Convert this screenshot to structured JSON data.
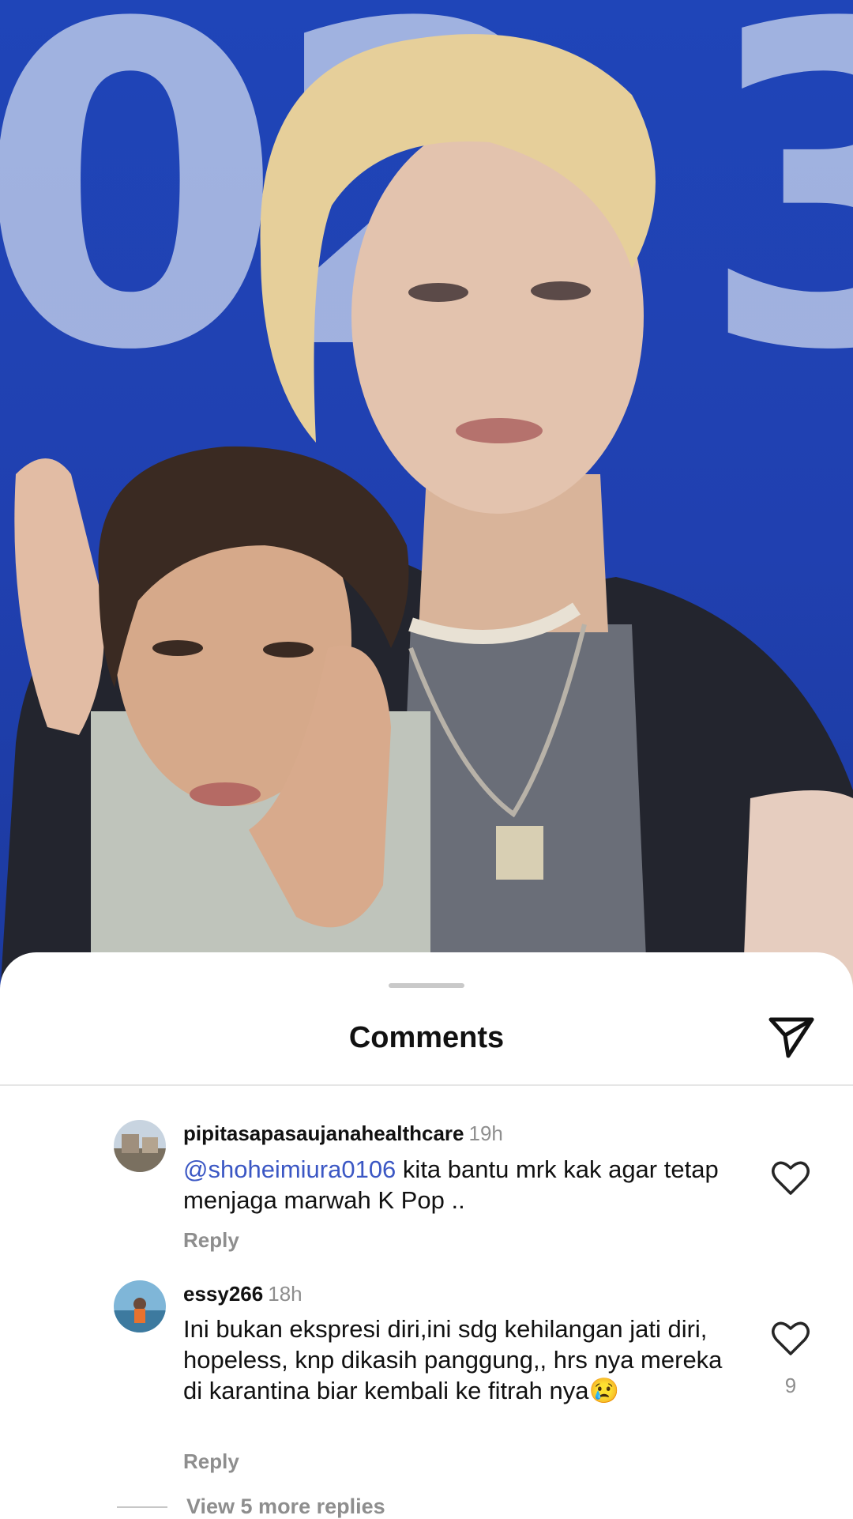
{
  "video": {
    "background_text": "02 3",
    "brand_color": "#2040b0"
  },
  "sheet": {
    "title": "Comments",
    "share_icon": "send-icon"
  },
  "comments": [
    {
      "username": "pipitasapasaujanahealthcare",
      "time": "19h",
      "mention": "@shoheimiura0106",
      "text": " kita bantu mrk kak agar tetap menjaga marwah K Pop ..",
      "reply_label": "Reply",
      "like_icon": "heart-icon"
    },
    {
      "username": "essy266",
      "time": "18h",
      "text": "Ini bukan ekspresi diri,ini sdg kehilangan jati diri, hopeless, knp dikasih panggung,, hrs nya mereka di karantina biar kembali ke fitrah nya",
      "emoji": "😢",
      "reply_label": "Reply",
      "like_icon": "heart-icon",
      "likes": "9"
    }
  ],
  "view_more": "View 5 more replies"
}
